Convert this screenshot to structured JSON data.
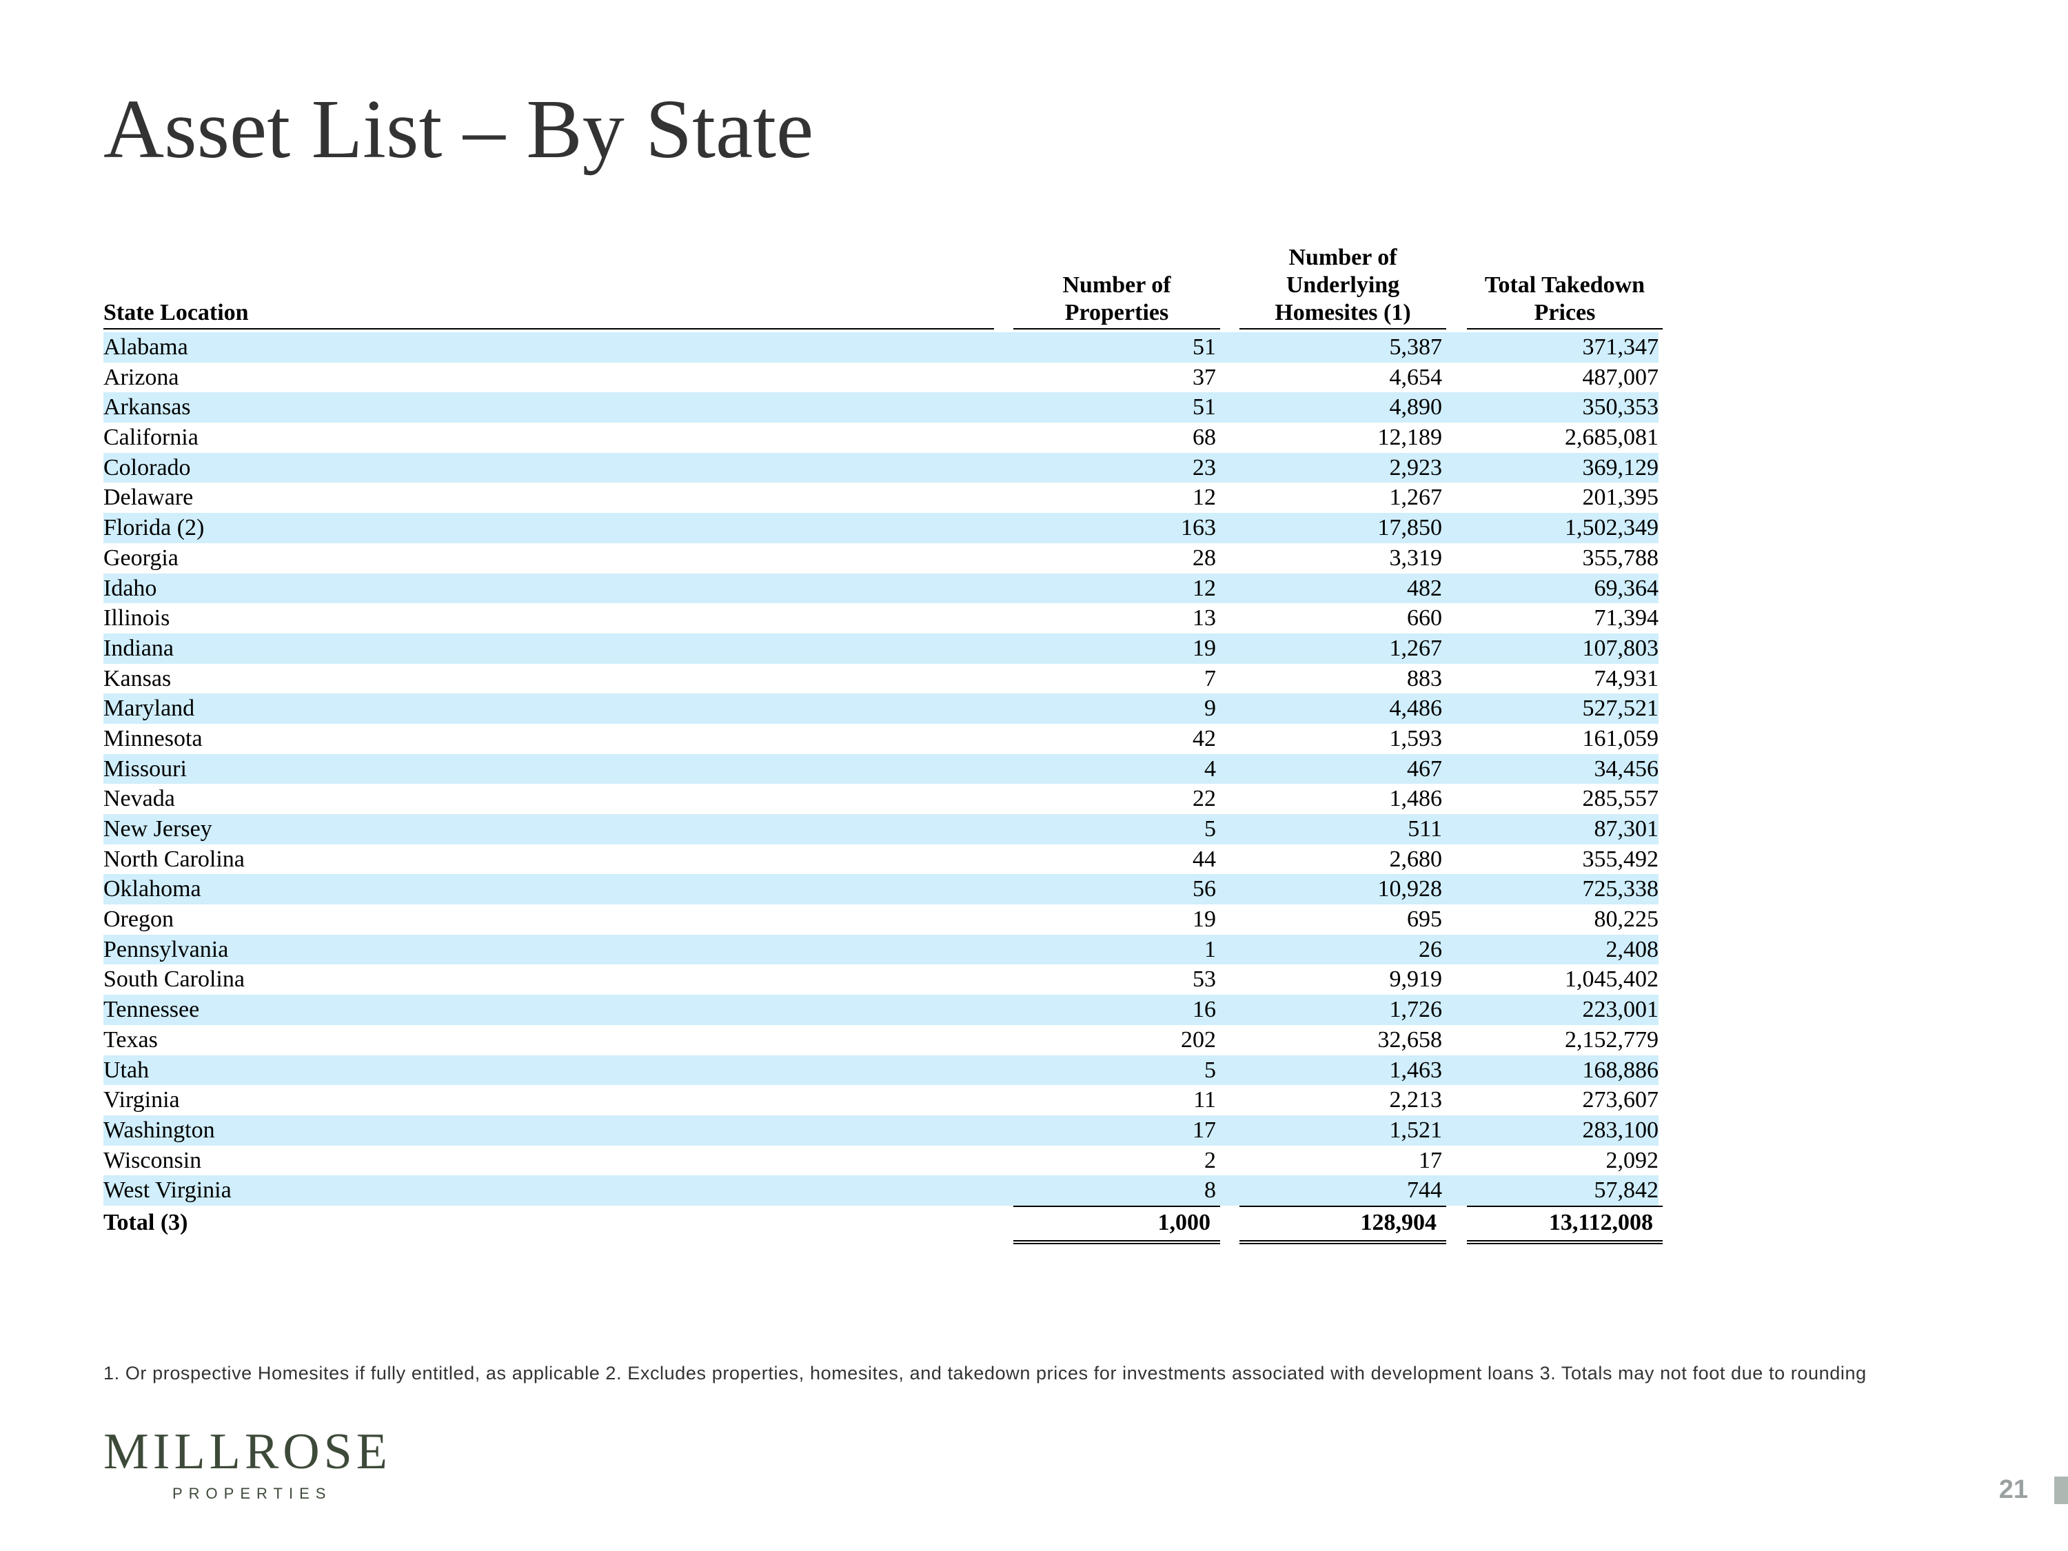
{
  "title": "Asset List – By State",
  "table": {
    "headers": {
      "state": "State Location",
      "properties_line1": "Number of",
      "properties_line2": "Properties",
      "homesites_line1": "Number of",
      "homesites_line2": "Underlying",
      "homesites_line3": "Homesites (1)",
      "takedown_line1": "Total Takedown",
      "takedown_line2": "Prices"
    },
    "rows": [
      {
        "state": "Alabama",
        "properties": "51",
        "homesites": "5,387",
        "takedown": "371,347"
      },
      {
        "state": "Arizona",
        "properties": "37",
        "homesites": "4,654",
        "takedown": "487,007"
      },
      {
        "state": "Arkansas",
        "properties": "51",
        "homesites": "4,890",
        "takedown": "350,353"
      },
      {
        "state": "California",
        "properties": "68",
        "homesites": "12,189",
        "takedown": "2,685,081"
      },
      {
        "state": "Colorado",
        "properties": "23",
        "homesites": "2,923",
        "takedown": "369,129"
      },
      {
        "state": "Delaware",
        "properties": "12",
        "homesites": "1,267",
        "takedown": "201,395"
      },
      {
        "state": "Florida (2)",
        "properties": "163",
        "homesites": "17,850",
        "takedown": "1,502,349"
      },
      {
        "state": "Georgia",
        "properties": "28",
        "homesites": "3,319",
        "takedown": "355,788"
      },
      {
        "state": "Idaho",
        "properties": "12",
        "homesites": "482",
        "takedown": "69,364"
      },
      {
        "state": "Illinois",
        "properties": "13",
        "homesites": "660",
        "takedown": "71,394"
      },
      {
        "state": "Indiana",
        "properties": "19",
        "homesites": "1,267",
        "takedown": "107,803"
      },
      {
        "state": "Kansas",
        "properties": "7",
        "homesites": "883",
        "takedown": "74,931"
      },
      {
        "state": "Maryland",
        "properties": "9",
        "homesites": "4,486",
        "takedown": "527,521"
      },
      {
        "state": "Minnesota",
        "properties": "42",
        "homesites": "1,593",
        "takedown": "161,059"
      },
      {
        "state": "Missouri",
        "properties": "4",
        "homesites": "467",
        "takedown": "34,456"
      },
      {
        "state": "Nevada",
        "properties": "22",
        "homesites": "1,486",
        "takedown": "285,557"
      },
      {
        "state": "New Jersey",
        "properties": "5",
        "homesites": "511",
        "takedown": "87,301"
      },
      {
        "state": "North Carolina",
        "properties": "44",
        "homesites": "2,680",
        "takedown": "355,492"
      },
      {
        "state": "Oklahoma",
        "properties": "56",
        "homesites": "10,928",
        "takedown": "725,338"
      },
      {
        "state": "Oregon",
        "properties": "19",
        "homesites": "695",
        "takedown": "80,225"
      },
      {
        "state": "Pennsylvania",
        "properties": "1",
        "homesites": "26",
        "takedown": "2,408"
      },
      {
        "state": "South Carolina",
        "properties": "53",
        "homesites": "9,919",
        "takedown": "1,045,402"
      },
      {
        "state": "Tennessee",
        "properties": "16",
        "homesites": "1,726",
        "takedown": "223,001"
      },
      {
        "state": "Texas",
        "properties": "202",
        "homesites": "32,658",
        "takedown": "2,152,779"
      },
      {
        "state": "Utah",
        "properties": "5",
        "homesites": "1,463",
        "takedown": "168,886"
      },
      {
        "state": "Virginia",
        "properties": "11",
        "homesites": "2,213",
        "takedown": "273,607"
      },
      {
        "state": "Washington",
        "properties": "17",
        "homesites": "1,521",
        "takedown": "283,100"
      },
      {
        "state": "Wisconsin",
        "properties": "2",
        "homesites": "17",
        "takedown": "2,092"
      },
      {
        "state": "West Virginia",
        "properties": "8",
        "homesites": "744",
        "takedown": "57,842"
      }
    ],
    "total": {
      "state": "Total (3)",
      "properties": "1,000",
      "homesites": "128,904",
      "takedown": "13,112,008"
    }
  },
  "footnote": "1. Or prospective Homesites if fully entitled, as applicable  2. Excludes properties, homesites, and takedown prices for investments associated with development loans  3. Totals may not foot due to rounding",
  "logo": {
    "main": "MILLROSE",
    "sub": "PROPERTIES"
  },
  "page_number": "21",
  "colors": {
    "row_shade": "#d0eefb",
    "title": "#333333",
    "logo": "#3d4a39"
  }
}
